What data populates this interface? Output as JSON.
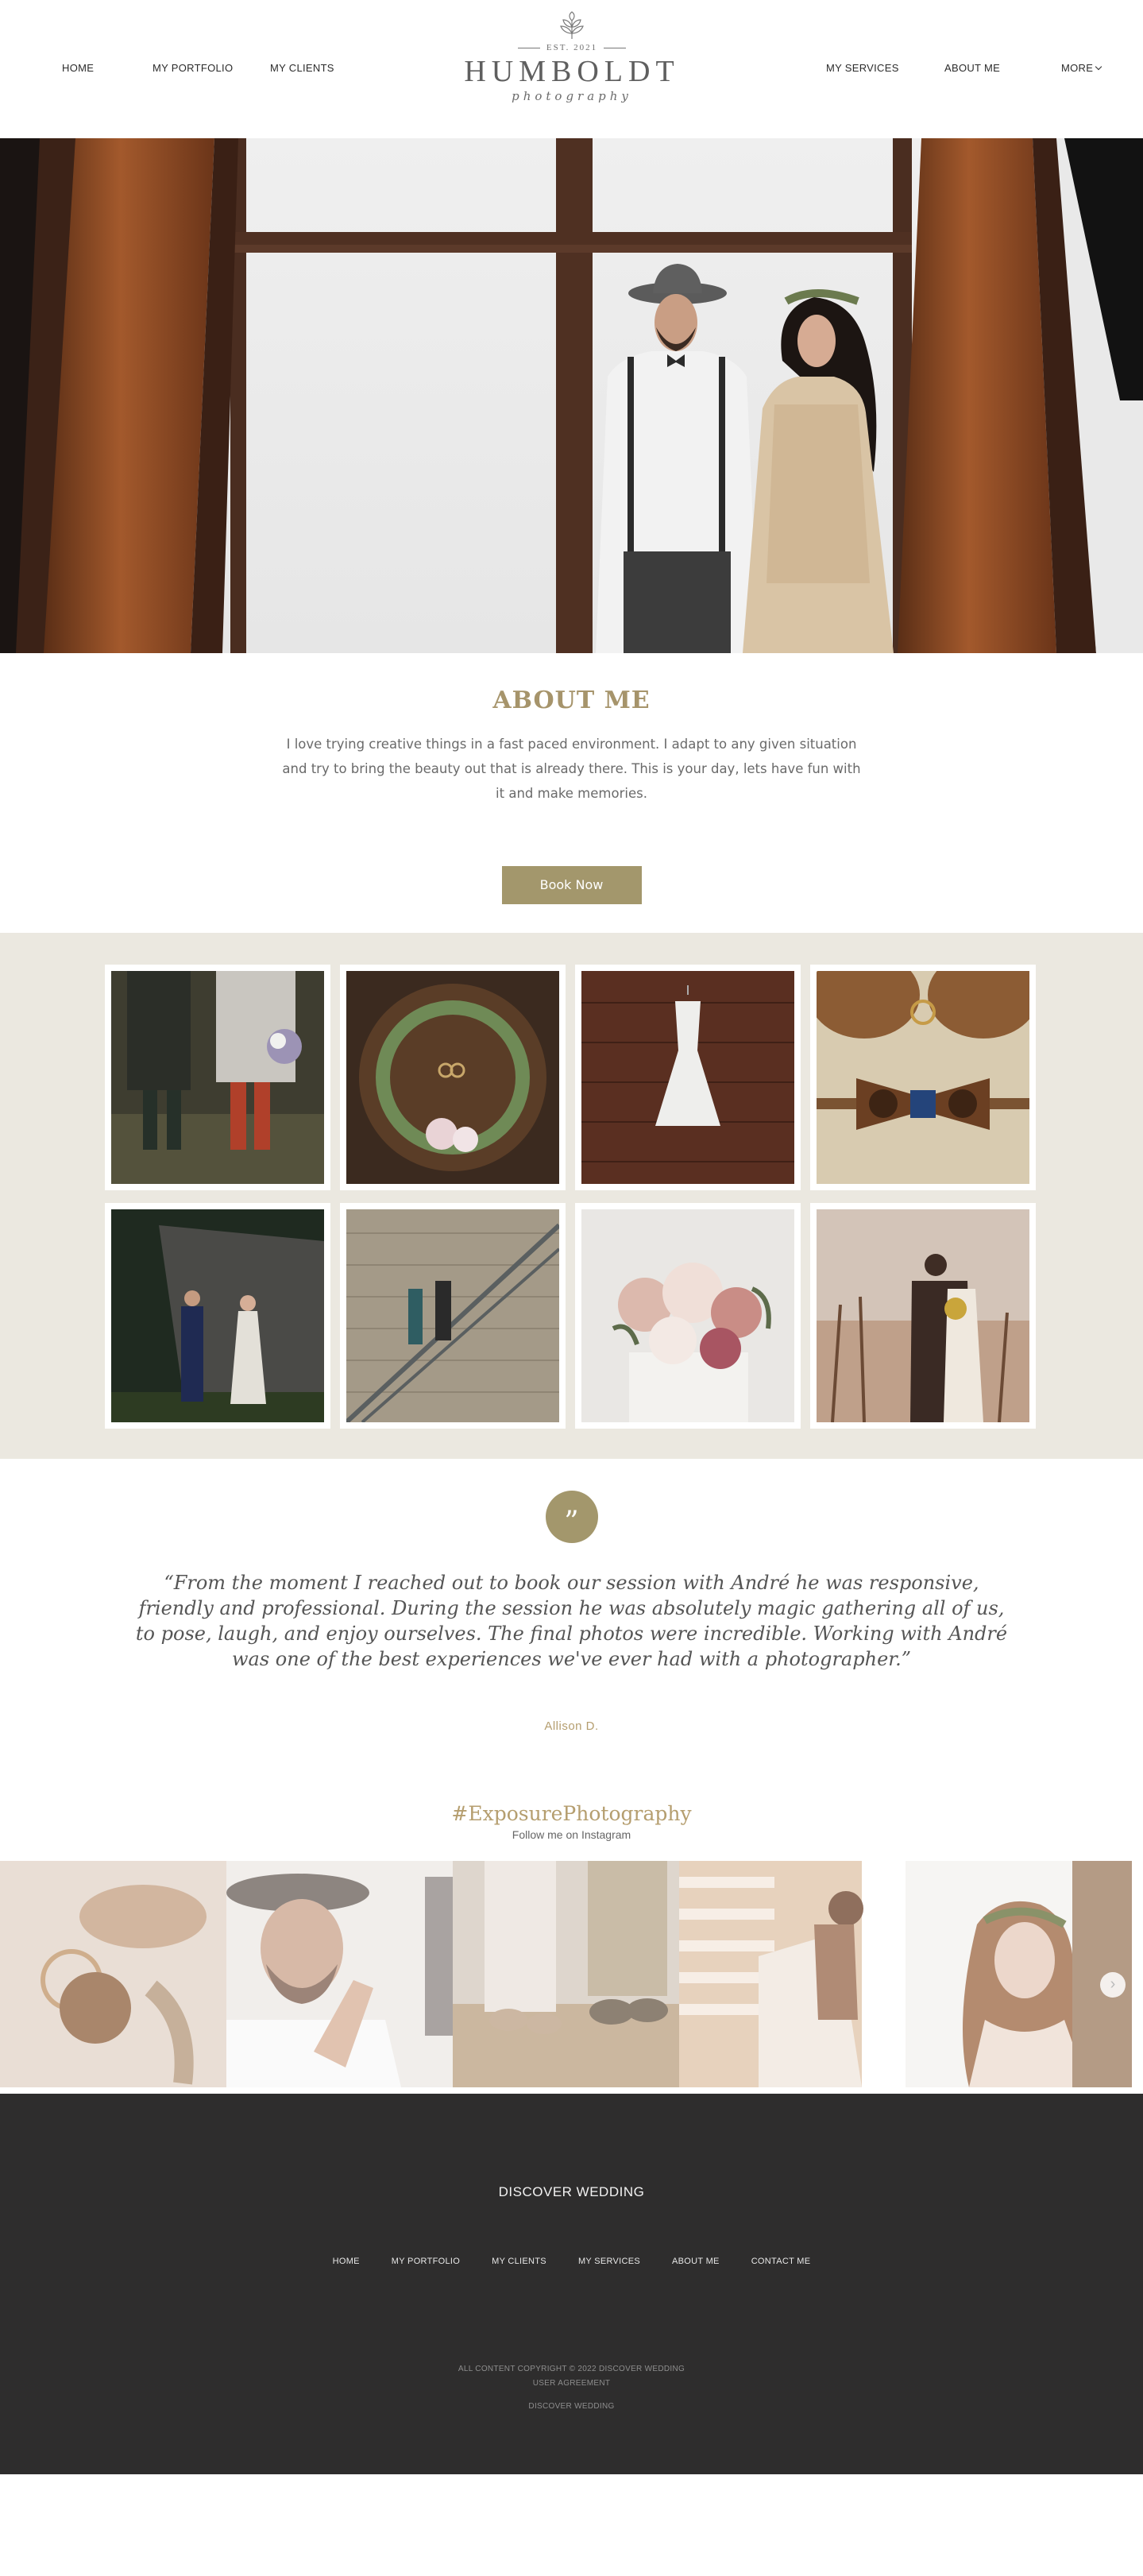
{
  "header": {
    "nav_left": [
      "HOME",
      "MY PORTFOLIO",
      "MY CLIENTS"
    ],
    "nav_right": [
      "MY SERVICES",
      "ABOUT ME",
      "MORE"
    ],
    "logo": {
      "est": "EST. 2021",
      "name": "HUMBOLDT",
      "sub": "photography",
      "icon": "leaf-icon"
    }
  },
  "hero": {
    "image": "couple-at-window-photo"
  },
  "about": {
    "title": "ABOUT ME",
    "text": "I love trying creative things in a fast paced environment. I adapt to any given situation and try to bring the beauty out that is already there. This is your day, lets have fun with it and make memories.",
    "button": "Book Now"
  },
  "gallery": {
    "items": [
      "boots-couple-photo",
      "wreath-rings-photo",
      "hanging-dress-photo",
      "bowtie-rings-photo",
      "couple-forest-photo",
      "stairs-couple-photo",
      "bouquet-photo",
      "hug-field-photo"
    ]
  },
  "testimonial": {
    "icon": "quote-icon",
    "quote_mark": "”",
    "text": "“From the moment I reached out to book our session with André he was responsive, friendly and professional. During the session he was absolutely magic gathering all of us, to pose, laugh, and enjoy ourselves. The final photos were incredible. Working with André was one of the best experiences we've ever had with a photographer.”",
    "author": "Allison D."
  },
  "instagram": {
    "tag": "#ExposurePhotography",
    "subtitle": "Follow me on Instagram",
    "items": [
      "rings-leaves-photo",
      "groom-hat-photo",
      "shoes-grass-photo",
      "bride-light-photo",
      "bride-crown-photo"
    ],
    "next_icon": "chevron-right-icon",
    "next_glyph": "›"
  },
  "footer": {
    "title": "DISCOVER WEDDING",
    "nav": [
      "HOME",
      "MY PORTFOLIO",
      "MY CLIENTS",
      "MY SERVICES",
      "ABOUT ME",
      "CONTACT ME"
    ],
    "copyright": "ALL CONTENT COPYRIGHT © 2022 DISCOVER WEDDING",
    "user_agreement": "USER AGREEMENT",
    "brand": "DISCOVER WEDDING"
  },
  "colors": {
    "accent": "#a3976c",
    "gold_text": "#b59e6f",
    "gallery_bg": "#ebe8e0",
    "footer_bg": "#2e2d2d"
  }
}
